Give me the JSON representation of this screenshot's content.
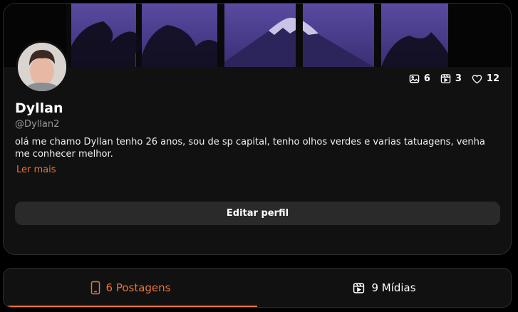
{
  "profile": {
    "name": "Dyllan",
    "handle": "@Dyllan2",
    "bio": "olá me chamo Dyllan tenho 26 anos, sou de sp capital, tenho olhos verdes e varias tatuagens, venha me conhecer melhor.",
    "read_more": "Ler mais",
    "edit_label": "Editar perfil"
  },
  "stats": {
    "photos": "6",
    "videos": "3",
    "likes": "12"
  },
  "tabs": [
    {
      "label": "6 Postagens",
      "icon": "phone-icon",
      "active": true
    },
    {
      "label": "9 Mídias",
      "icon": "media-icon",
      "active": false
    }
  ],
  "colors": {
    "accent": "#e8743b",
    "background": "#000000",
    "card": "#111111",
    "button": "#2a2a2a",
    "cover_sky": "#4a3f8c"
  }
}
